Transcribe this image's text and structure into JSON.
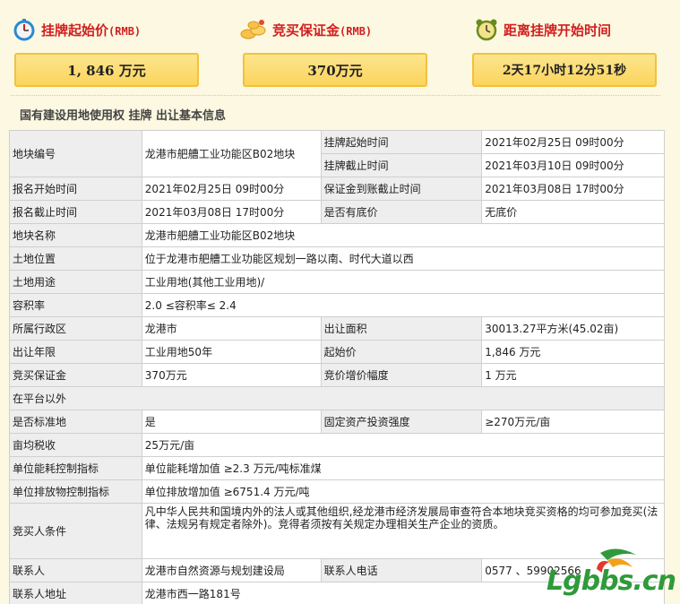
{
  "header": {
    "start_price": {
      "label": "挂牌起始价",
      "unit": "(RMB)",
      "value": "1, 846 万元",
      "icon": "stopwatch-icon"
    },
    "deposit": {
      "label": "竞买保证金",
      "unit": "(RMB)",
      "value": "370万元",
      "icon": "coins-icon"
    },
    "countdown": {
      "label": "距离挂牌开始时间",
      "value": "2天17小时12分51秒",
      "icon": "alarm-clock-icon"
    }
  },
  "section_title": "国有建设用地使用权 挂牌 出让基本信息",
  "table": {
    "parcel_no": {
      "label": "地块编号",
      "value": "龙港市舥艚工业功能区B02地块"
    },
    "list_start": {
      "label": "挂牌起始时间",
      "value": "2021年02月25日 09时00分"
    },
    "list_end": {
      "label": "挂牌截止时间",
      "value": "2021年03月10日 09时00分"
    },
    "reg_start": {
      "label": "报名开始时间",
      "value": "2021年02月25日 09时00分"
    },
    "deposit_deadline": {
      "label": "保证金到账截止时间",
      "value": "2021年03月08日 17时00分"
    },
    "reg_end": {
      "label": "报名截止时间",
      "value": "2021年03月08日 17时00分"
    },
    "reserve": {
      "label": "是否有底价",
      "value": "无底价"
    },
    "parcel_name": {
      "label": "地块名称",
      "value": "龙港市舥艚工业功能区B02地块"
    },
    "location": {
      "label": "土地位置",
      "value": "位于龙港市舥艚工业功能区规划一路以南、时代大道以西"
    },
    "usage": {
      "label": "土地用途",
      "value": "工业用地(其他工业用地)/"
    },
    "far": {
      "label": "容积率",
      "value": "2.0 ≤容积率≤ 2.4"
    },
    "district": {
      "label": "所属行政区",
      "value": "龙港市"
    },
    "area": {
      "label": "出让面积",
      "value": "30013.27平方米(45.02亩)"
    },
    "term": {
      "label": "出让年限",
      "value": "工业用地50年"
    },
    "start_price": {
      "label": "起始价",
      "value": "1,846 万元"
    },
    "bid_deposit": {
      "label": "竞买保证金",
      "value": "370万元"
    },
    "increment": {
      "label": "竞价增价幅度",
      "value": "1 万元"
    },
    "outside": {
      "label": "在平台以外"
    },
    "standard": {
      "label": "是否标准地",
      "value": "是"
    },
    "investment": {
      "label": "固定资产投资强度",
      "value": "≥270万元/亩"
    },
    "tax": {
      "label": "亩均税收",
      "value": "25万元/亩"
    },
    "energy": {
      "label": "单位能耗控制指标",
      "value": "单位能耗增加值 ≥2.3 万元/吨标准煤"
    },
    "emission": {
      "label": "单位排放物控制指标",
      "value": "单位排放增加值 ≥6751.4 万元/吨"
    },
    "bidder": {
      "label": "竞买人条件",
      "value": "凡中华人民共和国境内外的法人或其他组织,经龙港市经济发展局审查符合本地块竞买资格的均可参加竞买(法律、法规另有规定者除外)。竞得者须按有关规定办理相关生产企业的资质。"
    },
    "contact": {
      "label": "联系人",
      "value": "龙港市自然资源与规划建设局"
    },
    "phone": {
      "label": "联系人电话",
      "value": "0577        、59902566"
    },
    "address": {
      "label": "联系人地址",
      "value": "龙港市西一路181号"
    }
  },
  "watermark": {
    "text": "Lgbbs.cn"
  },
  "colors": {
    "accent_red": "#d01f1f",
    "gold": "#fbd45c",
    "page_bg": "#fdf8e1",
    "label_bg": "#eeeeee"
  }
}
